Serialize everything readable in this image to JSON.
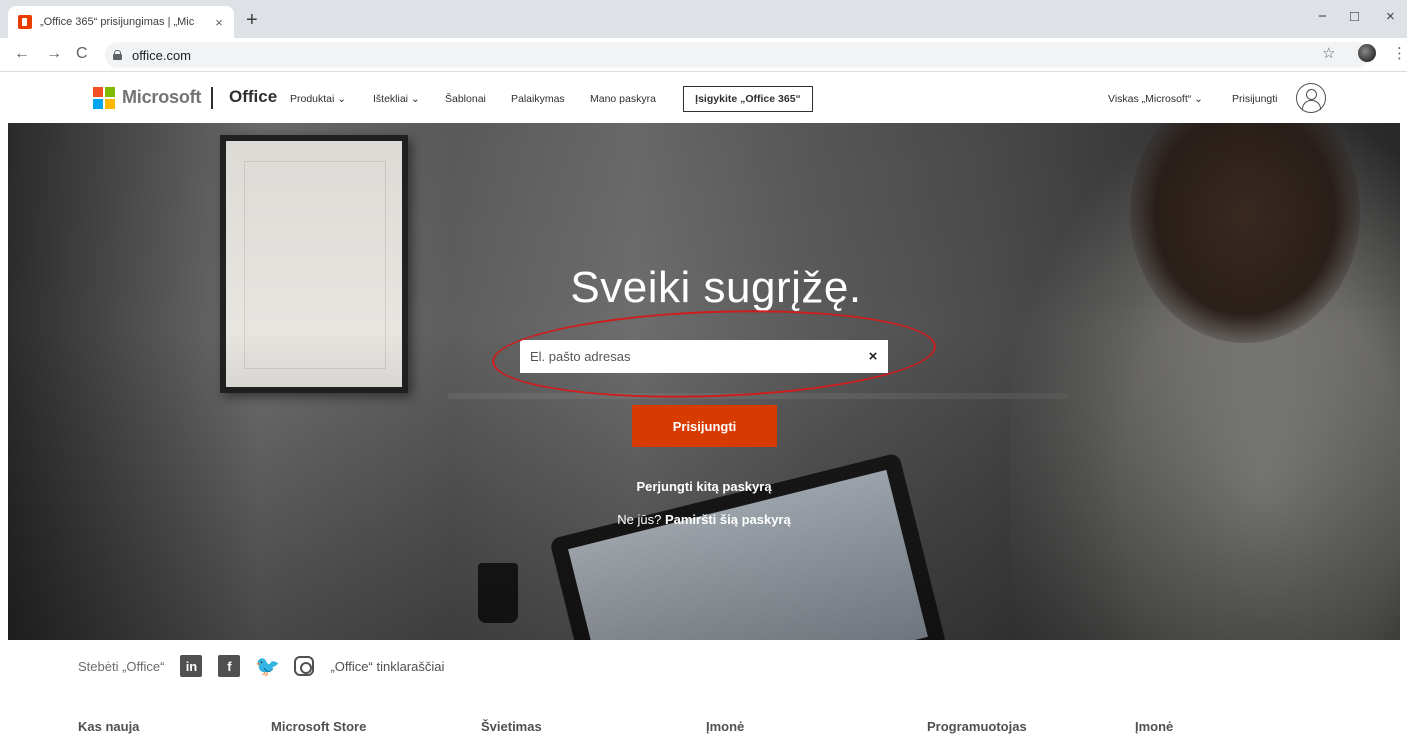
{
  "browser": {
    "tab_title": "„Office 365“ prisijungimas | „Mic",
    "tab_close": "×",
    "new_tab": "+",
    "url": "office.com",
    "back": "←",
    "forward": "→",
    "reload": "C",
    "star": "☆",
    "menu": "⋮",
    "minimize": "−",
    "maximize": "□",
    "close": "×"
  },
  "header": {
    "brand": "Microsoft",
    "product": "Office",
    "nav": [
      "Produktai ⌄",
      "Ištekliai ⌄",
      "Šablonai",
      "Palaikymas",
      "Mano paskyra"
    ],
    "cta": "Įsigykite „Office 365“",
    "all_microsoft": "Viskas „Microsoft“ ⌄",
    "sign_in": "Prisijungti"
  },
  "hero": {
    "title": "Sveiki sugrįžę.",
    "email_placeholder": "El. pašto adresas",
    "clear": "×",
    "signin_button": "Prisijungti",
    "switch_account": "Perjungti kitą paskyrą",
    "not_you_prefix": "Ne jūs? ",
    "forget_account": "Pamiršti šią paskyrą"
  },
  "footer": {
    "follow_label": "Stebėti „Office“",
    "social": {
      "linkedin": "in",
      "facebook": "f",
      "twitter": "🐦"
    },
    "blogs": "„Office“ tinklaraščiai",
    "columns": [
      "Kas nauja",
      "Microsoft Store",
      "Švietimas",
      "Įmonė",
      "Programuotojas",
      "Įmonė"
    ]
  },
  "colors": {
    "accent": "#d83b01",
    "annotation": "#d01c1c"
  }
}
